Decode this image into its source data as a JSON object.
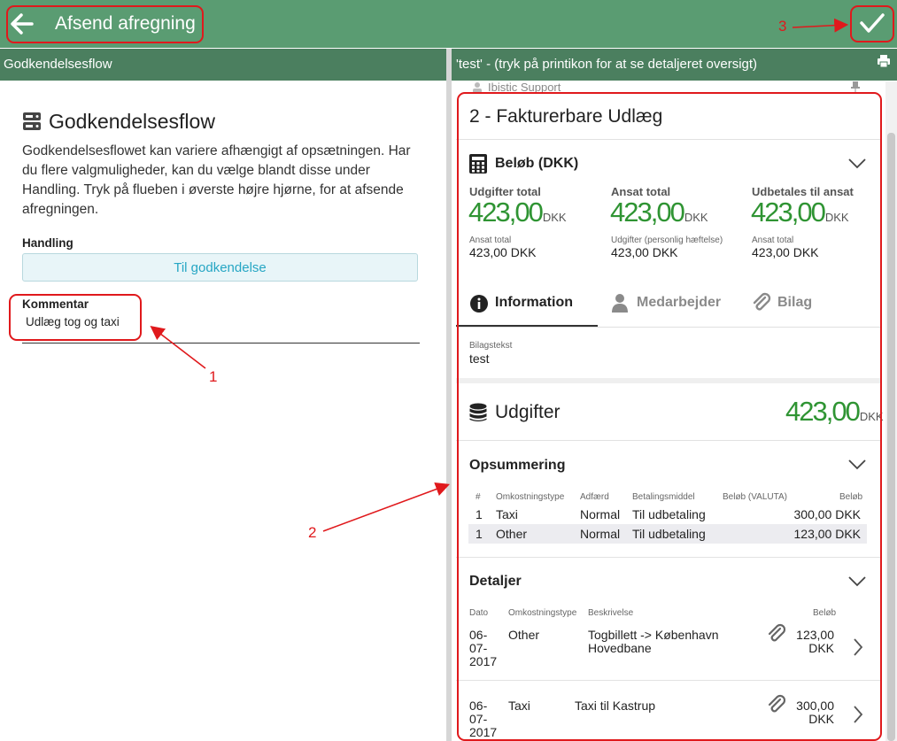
{
  "header": {
    "title": "Afsend afregning",
    "back_icon": "arrow-left-icon",
    "confirm_icon": "checkmark-icon"
  },
  "left_panel": {
    "subheader": "Godkendelsesflow",
    "title": "Godkendelsesflow",
    "description": "Godkendelsesflowet kan variere afhængigt af opsætningen. Har du flere valgmuligheder, kan du vælge blandt disse under Handling. Tryk på flueben i øverste højre hjørne, for at afsende afregningen.",
    "handling_label": "Handling",
    "handling_value": "Til godkendelse",
    "comment_label": "Kommentar",
    "comment_value": "Udlæg tog og taxi"
  },
  "right_panel": {
    "subheader": "'test' - (tryk på printikon for at se detaljeret oversigt)",
    "ghost_row": "Ibistic Support",
    "card_title": "2 - Fakturerbare Udlæg",
    "amount_section": {
      "title": "Beløb (DKK)",
      "stats": [
        {
          "label": "Udgifter total",
          "value": "423,00",
          "currency": "DKK",
          "sub_label": "Ansat total",
          "sub_value": "423,00 DKK"
        },
        {
          "label": "Ansat total",
          "value": "423,00",
          "currency": "DKK",
          "sub_label": "Udgifter (personlig hæftelse)",
          "sub_value": "423,00 DKK"
        },
        {
          "label": "Udbetales til ansat",
          "value": "423,00",
          "currency": "DKK",
          "sub_label": "Ansat total",
          "sub_value": "423,00 DKK"
        }
      ]
    },
    "tabs": [
      {
        "label": "Information",
        "active": true
      },
      {
        "label": "Medarbejder",
        "active": false
      },
      {
        "label": "Bilag",
        "active": false
      }
    ],
    "bilagstekst_label": "Bilagstekst",
    "bilagstekst_value": "test",
    "expenses": {
      "title": "Udgifter",
      "total": "423,00",
      "currency": "DKK"
    },
    "summary": {
      "title": "Opsummering",
      "columns": [
        "#",
        "Omkostningstype",
        "Adfærd",
        "Betalingsmiddel",
        "Beløb (VALUTA)",
        "Beløb"
      ],
      "rows": [
        {
          "num": "1",
          "type": "Taxi",
          "behavior": "Normal",
          "payment": "Til udbetaling",
          "amount_currency": "",
          "amount": "300,00 DKK"
        },
        {
          "num": "1",
          "type": "Other",
          "behavior": "Normal",
          "payment": "Til udbetaling",
          "amount_currency": "",
          "amount": "123,00 DKK"
        }
      ]
    },
    "details": {
      "title": "Detaljer",
      "columns": [
        "Dato",
        "Omkostningstype",
        "Beskrivelse",
        "Beløb"
      ],
      "rows": [
        {
          "date_lines": [
            "06-",
            "07-",
            "2017"
          ],
          "type": "Other",
          "desc_lines": [
            "Togbillett -> København",
            "Hovedbane"
          ],
          "amount_lines": [
            "123,00",
            "DKK"
          ]
        },
        {
          "date_lines": [
            "06-",
            "07-",
            "2017"
          ],
          "type": "Taxi",
          "desc_lines": [
            "Taxi til Kastrup"
          ],
          "amount_lines": [
            "300,00",
            "DKK"
          ]
        }
      ]
    }
  },
  "annotations": {
    "label_1": "1",
    "label_2": "2",
    "label_3": "3",
    "color": "#e0191c"
  },
  "colors": {
    "topbar": "#5a9c72",
    "subheader": "#4b7f5f",
    "amount_green": "#2f9433",
    "accent_blue": "#26a6c4"
  }
}
